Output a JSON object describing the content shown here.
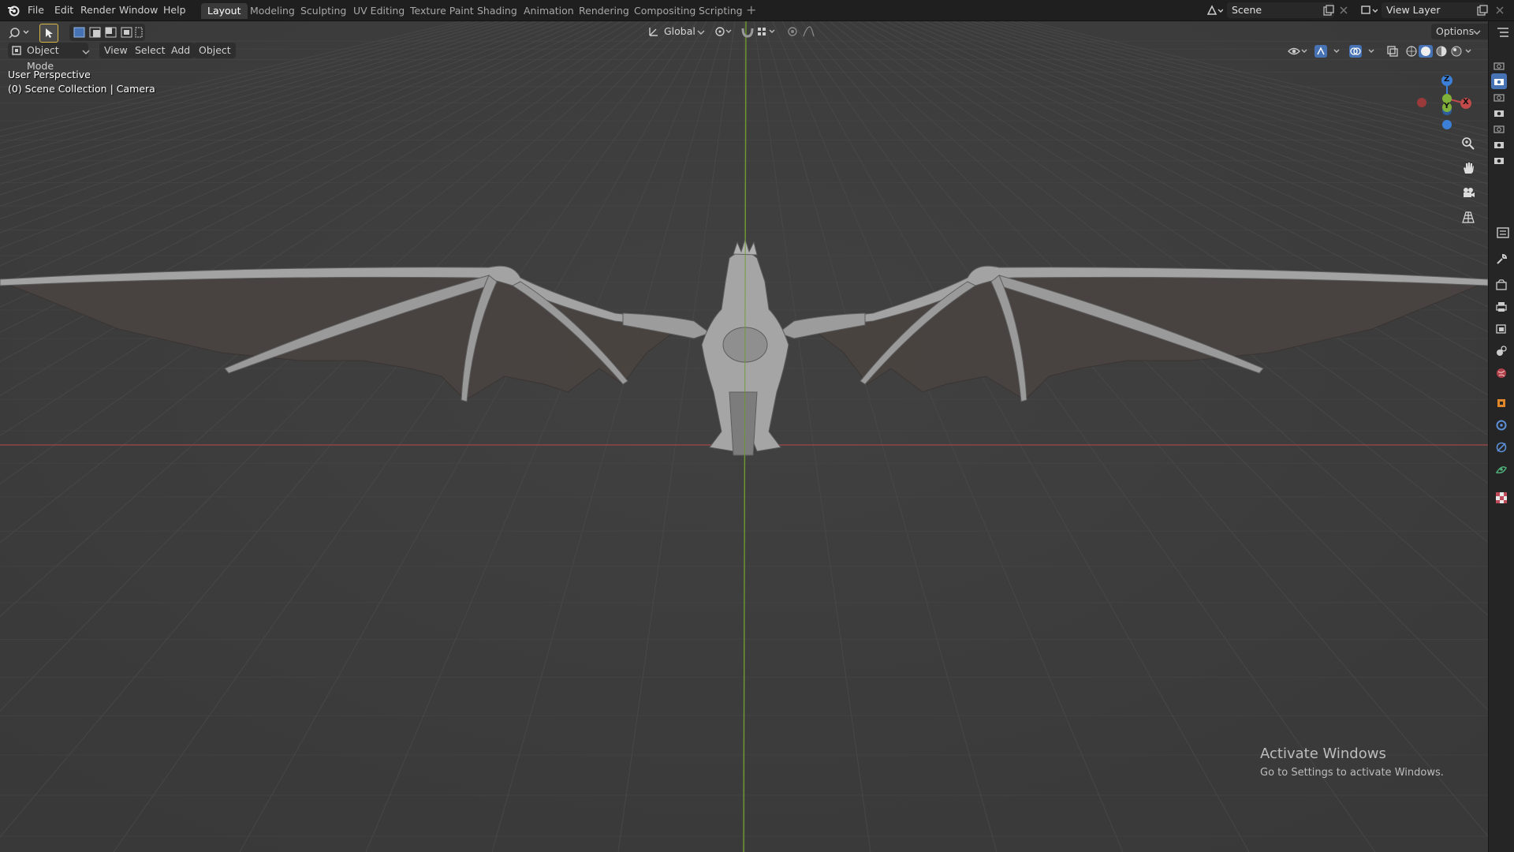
{
  "topbar": {
    "menus": [
      "File",
      "Edit",
      "Render",
      "Window",
      "Help"
    ],
    "workspaces": [
      "Layout",
      "Modeling",
      "Sculpting",
      "UV Editing",
      "Texture Paint",
      "Shading",
      "Animation",
      "Rendering",
      "Compositing",
      "Scripting"
    ],
    "active_workspace": "Layout",
    "add_workspace": "+",
    "scene_name": "Scene",
    "view_layer_name": "View Layer"
  },
  "toolheader": {
    "transform_orientation": "Global",
    "options_label": "Options"
  },
  "viewport_header": {
    "mode": "Object Mode",
    "menus": [
      "View",
      "Select",
      "Add",
      "Object"
    ]
  },
  "viewport": {
    "perspective": "User Perspective",
    "collection": "(0) Scene Collection | Camera",
    "gizmo_axes": {
      "x": "X",
      "y": "Y",
      "z": "Z"
    }
  },
  "watermark": {
    "title": "Activate Windows",
    "subtitle": "Go to Settings to activate Windows."
  },
  "colors": {
    "viewport_bg": "#3d3d3d",
    "x_axis": "#c24a4a",
    "y_axis": "#7fb13a",
    "z_axis": "#3b7fd6",
    "active_tab": "#3a3a3a"
  }
}
